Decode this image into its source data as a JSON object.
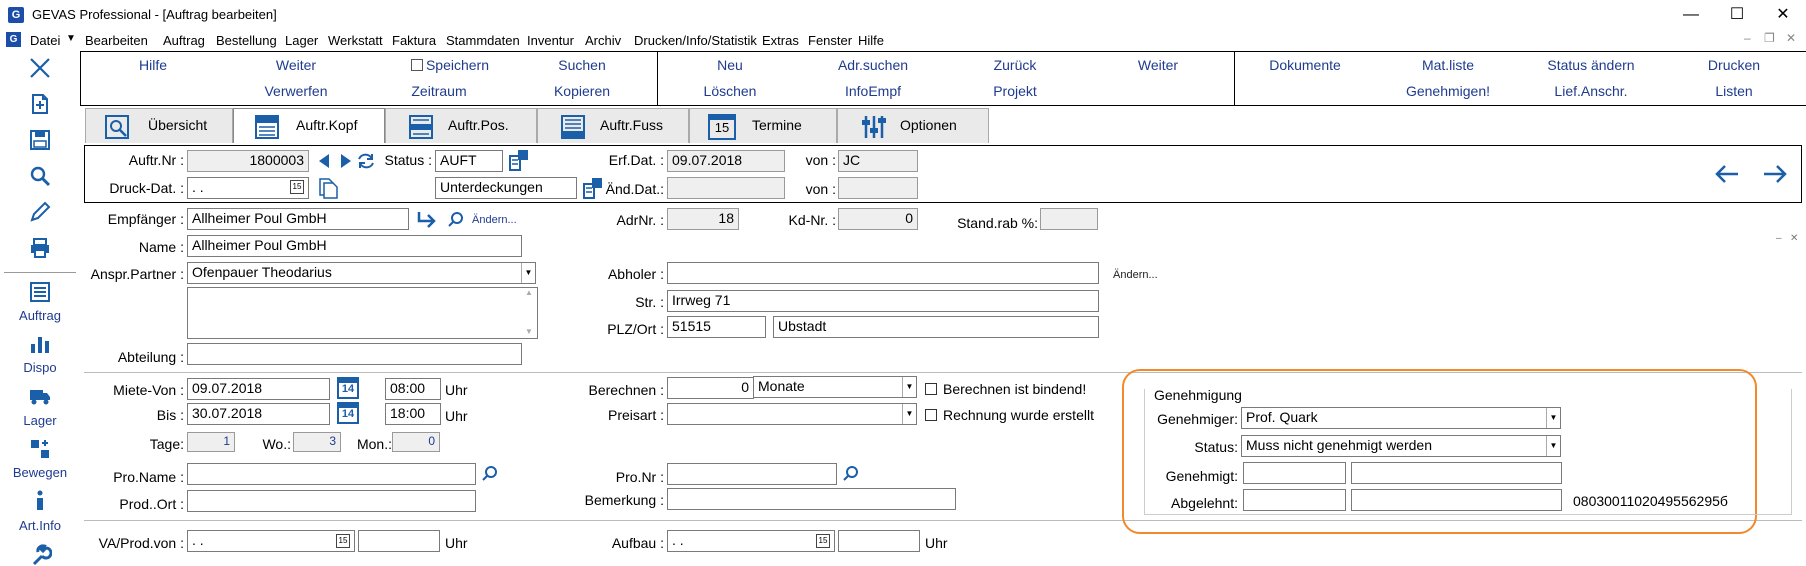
{
  "window": {
    "title": "GEVAS Professional - [Auftrag bearbeiten]",
    "minimize": "—",
    "maximize": "☐",
    "close": "✕",
    "app_icon_letter": "G"
  },
  "menu": [
    "Datei",
    "Bearbeiten",
    "Auftrag",
    "Bestellung",
    "Lager",
    "Werkstatt",
    "Faktura",
    "Stammdaten",
    "Inventur",
    "Archiv",
    "Drucken/Info/Statistik",
    "Extras",
    "Fenster",
    "Hilfe"
  ],
  "toolbar": {
    "row1": [
      "Hilfe",
      "Weiter",
      "Speichern",
      "Suchen",
      "Neu",
      "Adr.suchen",
      "Zurück",
      "Weiter",
      "Dokumente",
      "Mat.liste",
      "Status ändern",
      "Drucken"
    ],
    "row2": [
      "",
      "Verwerfen",
      "Zeitraum",
      "Kopieren",
      "Löschen",
      "InfoEmpf",
      "Projekt",
      "",
      "",
      "Genehmigen!",
      "Lief.Anschr.",
      "Listen"
    ]
  },
  "tabs": [
    "Übersicht",
    "Auftr.Kopf",
    "Auftr.Pos.",
    "Auftr.Fuss",
    "Termine",
    "Optionen"
  ],
  "tab_termine_day": "15",
  "sidebar": [
    "Auftrag",
    "Dispo",
    "Lager",
    "Bewegen",
    "Art.Info"
  ],
  "header": {
    "auftr_nr_label": "Auftr.Nr :",
    "auftr_nr": "1800003",
    "status_label": "Status :",
    "status": "AUFT",
    "erf_dat_label": "Erf.Dat. :",
    "erf_dat": "09.07.2018",
    "von_label": "von :",
    "von1": "JC",
    "druck_dat_label": "Druck-Dat. :",
    "druck_dat": " .  .",
    "unterdeckungen": "Unterdeckungen",
    "aend_dat_label": "Änd.Dat.:",
    "aend_dat": "",
    "von2": ""
  },
  "address": {
    "empfaenger_label": "Empfänger :",
    "empfaenger": "Allheimer Poul GmbH",
    "aendern1": "Ändern...",
    "adrnr_label": "AdrNr. :",
    "adrnr": "18",
    "kdnr_label": "Kd-Nr. :",
    "kdnr": "0",
    "standrab_label": "Stand.rab %:",
    "standrab": "",
    "name_label": "Name :",
    "name": "Allheimer Poul GmbH",
    "ansp_label": "Anspr.Partner :",
    "ansp": "Ofenpauer Theodarius",
    "abholer_label": "Abholer :",
    "abholer": "",
    "aendern2": "Ändern...",
    "str_label": "Str. :",
    "str": "Irrweg 71",
    "plz_label": "PLZ/Ort :",
    "plz": "51515",
    "ort": "Ubstadt",
    "abteilung_label": "Abteilung :",
    "abteilung": ""
  },
  "rental": {
    "miete_von_label": "Miete-Von :",
    "miete_von": "09.07.2018",
    "time_von": "08:00",
    "uhr": "Uhr",
    "bis_label": "Bis :",
    "bis": "30.07.2018",
    "time_bis": "18:00",
    "cal_day": "14",
    "tage_label": "Tage:",
    "tage": "1",
    "wo_label": "Wo.:",
    "wo": "3",
    "mon_label": "Mon.:",
    "mon": "0",
    "berechnen_label": "Berechnen :",
    "berechnen": "0",
    "monate": "Monate",
    "preisart_label": "Preisart :",
    "preisart": "",
    "chk1": "Berechnen ist bindend!",
    "chk2": "Rechnung wurde erstellt",
    "proname_label": "Pro.Name :",
    "proname": "",
    "prodort_label": "Prod..Ort :",
    "prodort": "",
    "pronr_label": "Pro.Nr :",
    "pronr": "",
    "bemerkung_label": "Bemerkung :",
    "bemerkung": "",
    "va_label": "VA/Prod.von :",
    "va": " .  .",
    "aufbau_label": "Aufbau :",
    "aufbau": " .  ."
  },
  "genehmigung": {
    "title": "Genehmigung",
    "genehmiger_label": "Genehmiger:",
    "genehmiger": "Prof. Quark",
    "status_label": "Status:",
    "status": "Muss nicht genehmigt werden",
    "genehmigt_label": "Genehmigt:",
    "genehmigt1": "",
    "genehmigt2": "",
    "abgelehnt_label": "Abgelehnt:",
    "abgelehnt1": "",
    "abgelehnt2": "",
    "code": "0803001102049556295б"
  },
  "colors": {
    "link": "#1f3b8f",
    "highlight": "#f08a2b",
    "icon": "#1a5fa8"
  }
}
